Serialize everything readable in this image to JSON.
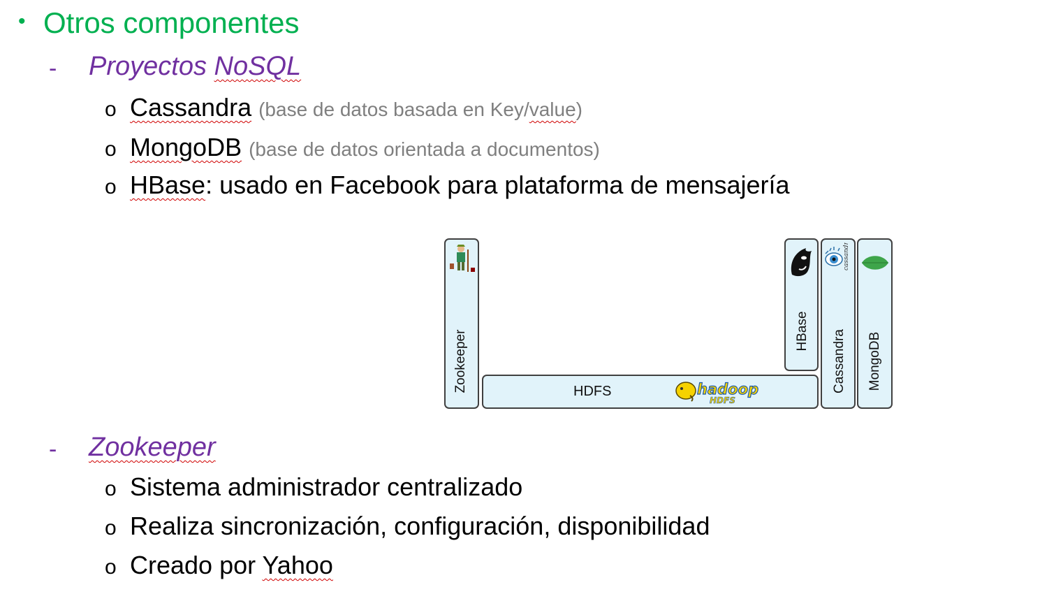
{
  "title": "Otros componentes",
  "sections": [
    {
      "dash": "-",
      "heading_prefix": "Proyectos ",
      "heading_underlined": "NoSQL",
      "items": [
        {
          "marker": "o",
          "name": "Cassandra",
          "note_pre": "(base de datos basada en Key/",
          "note_underlined": "value",
          "note_post": ")"
        },
        {
          "marker": "o",
          "name": "MongoDB",
          "note": "(base de datos orientada a documentos)"
        },
        {
          "marker": "o",
          "name": "HBase",
          "rest": ": usado en Facebook para plataforma de mensajería"
        }
      ]
    },
    {
      "dash": "-",
      "heading": "Zookeeper",
      "items": [
        {
          "marker": "o",
          "text": "Sistema administrador centralizado"
        },
        {
          "marker": "o",
          "text": "Realiza sincronización, configuración, disponibilidad"
        },
        {
          "marker": "o",
          "text_pre": "Creado por ",
          "text_underlined": "Yahoo"
        }
      ]
    }
  ],
  "diagram": {
    "zookeeper": "Zookeeper",
    "hdfs": "HDFS",
    "hadoop_logo_text": "hadoop",
    "hadoop_logo_sub": "HDFS",
    "hbase": "HBase",
    "cassandra": "Cassandra",
    "cassandra_logo_text": "cassandra",
    "mongodb": "MongoDB"
  },
  "colors": {
    "title": "#00b050",
    "section": "#7030a0",
    "note": "#7f7f7f",
    "box_fill": "#e1f3fa"
  }
}
